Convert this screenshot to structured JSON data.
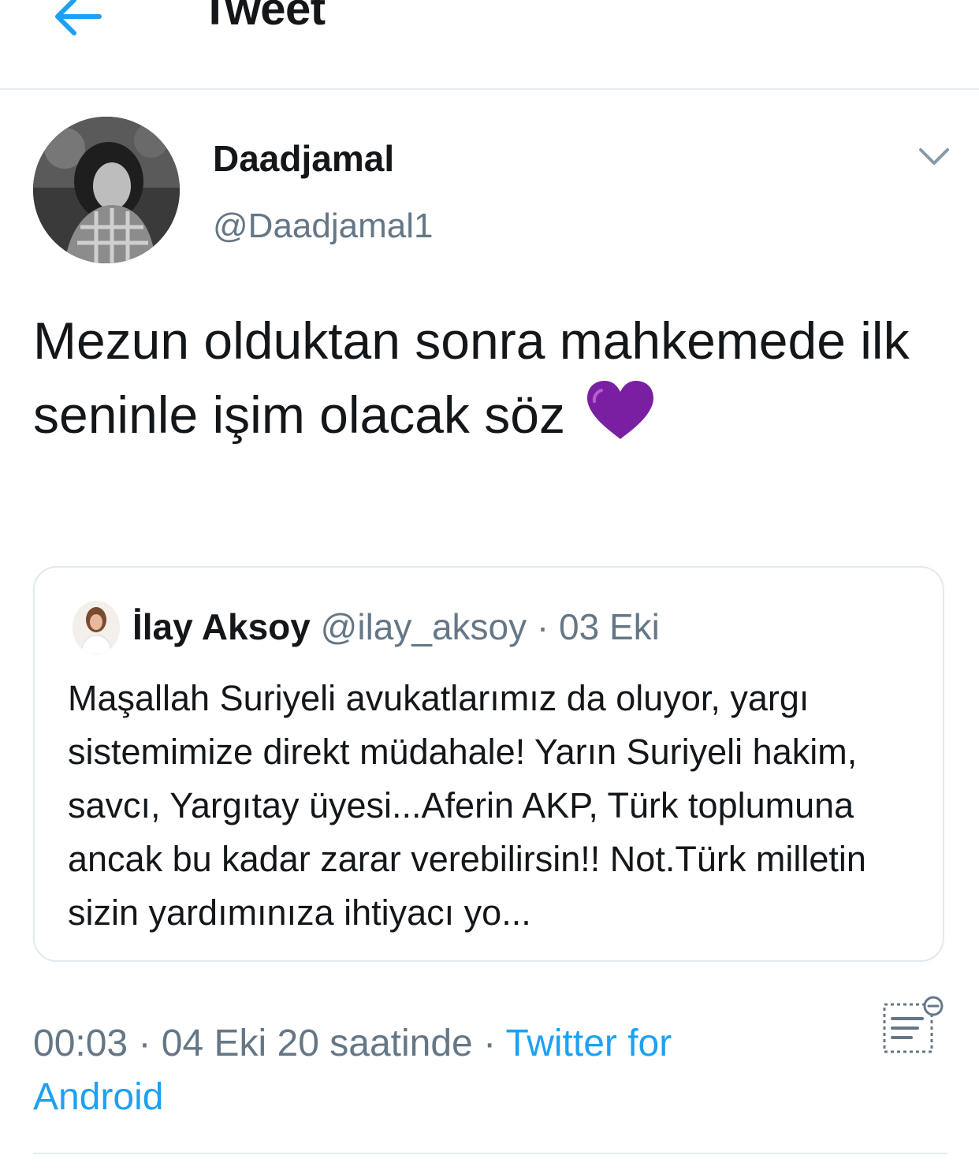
{
  "header": {
    "title": "Tweet",
    "back_icon": "arrow-left-icon"
  },
  "tweet": {
    "author": {
      "display_name": "Daadjamal",
      "handle": "@Daadjamal1"
    },
    "text": "Mezun olduktan sonra mahkemede ilk seninle işim olacak söz",
    "emoji": "purple-heart-icon",
    "more_icon": "chevron-down-icon"
  },
  "quoted_tweet": {
    "author_name": "İlay Aksoy",
    "handle": "@ilay_aksoy",
    "separator": " · ",
    "date": "03 Eki",
    "text": "Maşallah Suriyeli avukatlarımız da oluyor, yargı sistemimize direkt müdahale! Yarın Suriyeli hakim, savcı, Yargıtay üyesi...Aferin AKP, Türk toplumuna ancak bu kadar zarar verebilirsin!! Not.Türk milletin sizin yardımınıza ihtiyacı yo..."
  },
  "meta": {
    "time": "00:03",
    "separator": " · ",
    "date_text": "04 Eki 20 saatinde",
    "source": "Twitter for Android"
  },
  "colors": {
    "accent": "#1da1f2",
    "secondary_text": "#657786",
    "primary_text": "#14171a",
    "border": "#e1e8ed",
    "heart": "#7b1fa2"
  }
}
